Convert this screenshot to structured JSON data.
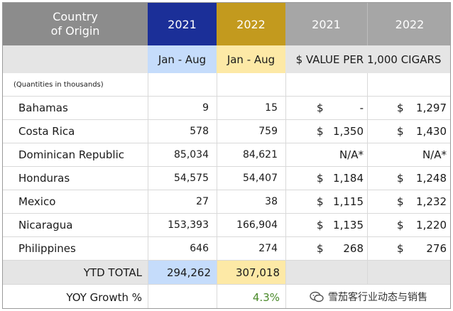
{
  "header": {
    "origin_label_line1": "Country",
    "origin_label_line2": "of Origin",
    "col_2021": "2021",
    "col_2022": "2022",
    "col_2021_value": "2021",
    "col_2022_value": "2022"
  },
  "subheader": {
    "period_2021": "Jan - Aug",
    "period_2022": "Jan - Aug",
    "value_title": "$ VALUE PER 1,000 CIGARS"
  },
  "note": "(Quantities in thousands)",
  "rows": [
    {
      "country": "Bahamas",
      "q2021": "9",
      "q2022": "15",
      "d2021": "$",
      "v2021": "-",
      "d2022": "$",
      "v2022": "1,297"
    },
    {
      "country": "Costa Rica",
      "q2021": "578",
      "q2022": "759",
      "d2021": "$",
      "v2021": "1,350",
      "d2022": "$",
      "v2022": "1,430"
    },
    {
      "country": "Dominican Republic",
      "q2021": "85,034",
      "q2022": "84,621",
      "d2021": "",
      "v2021": "N/A*",
      "d2022": "",
      "v2022": "N/A*"
    },
    {
      "country": "Honduras",
      "q2021": "54,575",
      "q2022": "54,407",
      "d2021": "$",
      "v2021": "1,184",
      "d2022": "$",
      "v2022": "1,248"
    },
    {
      "country": "Mexico",
      "q2021": "27",
      "q2022": "38",
      "d2021": "$",
      "v2021": "1,115",
      "d2022": "$",
      "v2022": "1,232"
    },
    {
      "country": "Nicaragua",
      "q2021": "153,393",
      "q2022": "166,904",
      "d2021": "$",
      "v2021": "1,135",
      "d2022": "$",
      "v2022": "1,220"
    },
    {
      "country": "Philippines",
      "q2021": "646",
      "q2022": "274",
      "d2021": "$",
      "v2021": "268",
      "d2022": "$",
      "v2022": "276"
    }
  ],
  "total": {
    "label": "YTD TOTAL",
    "q2021": "294,262",
    "q2022": "307,018"
  },
  "growth": {
    "label": "YOY Growth %",
    "value": "4.3%"
  },
  "watermark": {
    "text": "雪茄客行业动态与销售",
    "icon": "wechat-icon"
  },
  "colors": {
    "header_gray": "#8c8c8c",
    "header_blue": "#1b2f98",
    "header_gold": "#c39a1e",
    "value_header_gray": "#a6a6a6",
    "light_blue": "#c5dcfb",
    "light_yellow": "#fde9a6",
    "light_gray": "#e5e5e5",
    "growth_green": "#4a8a2a"
  }
}
